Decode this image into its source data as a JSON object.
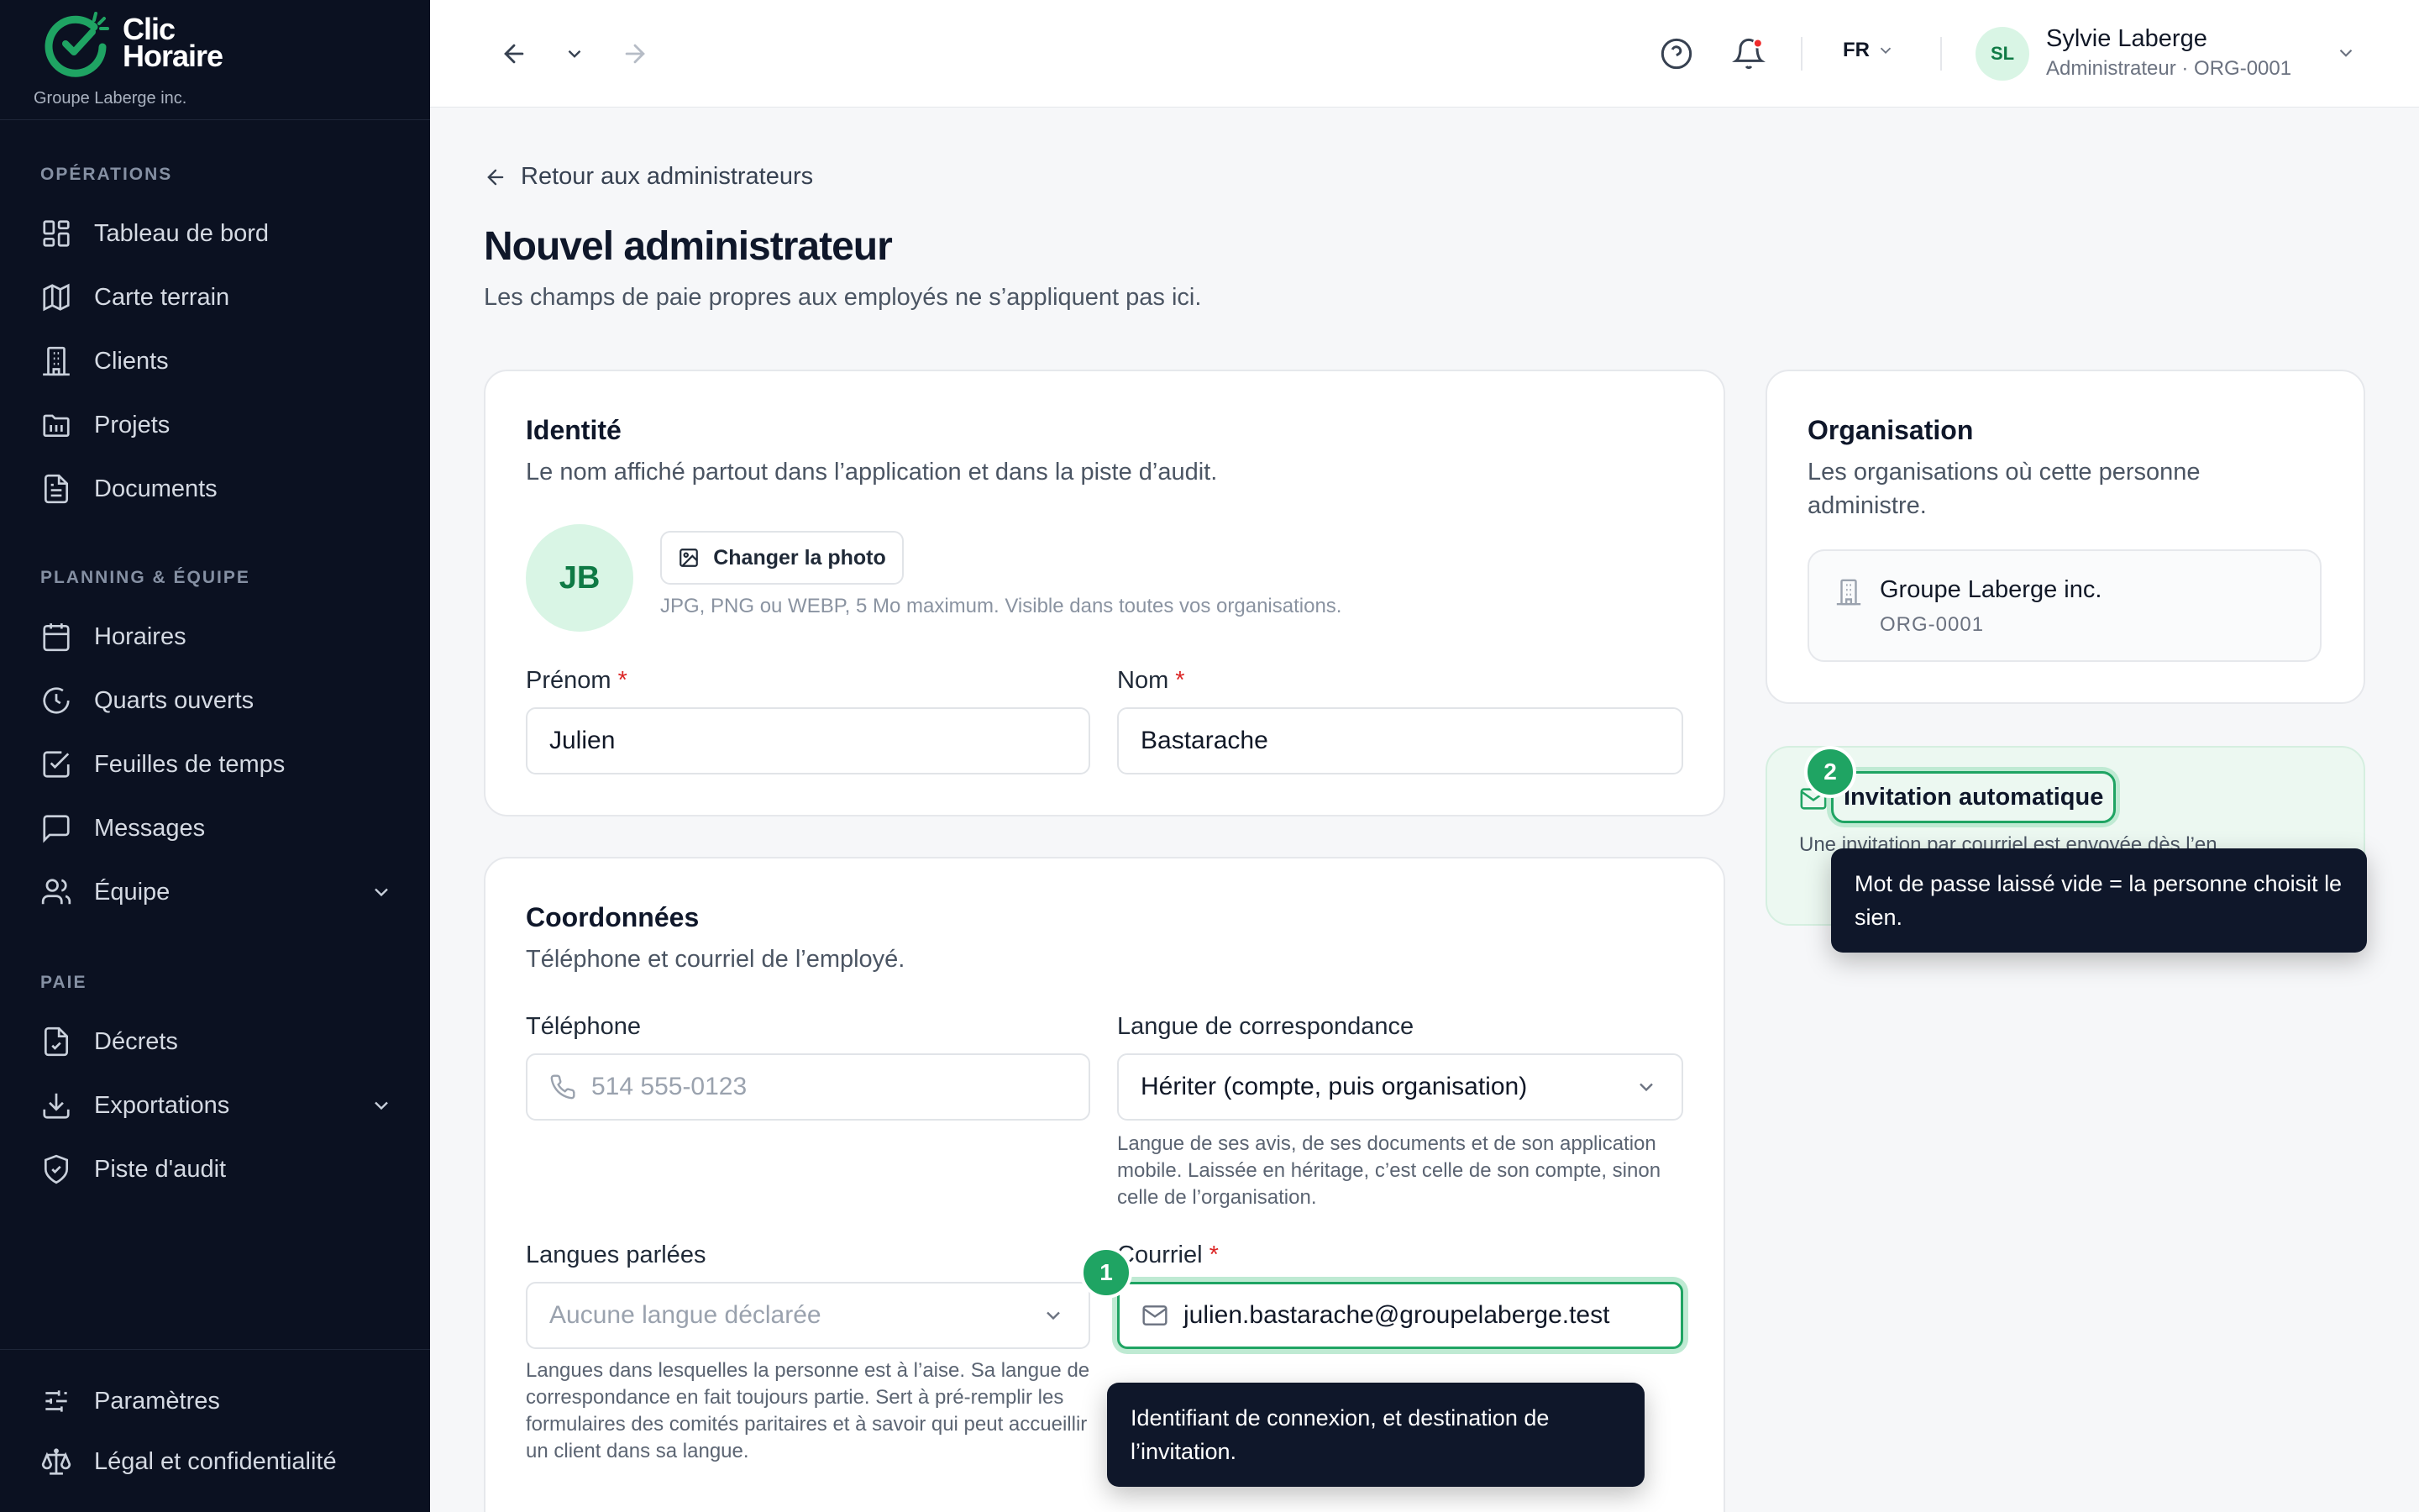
{
  "brand": {
    "name_line1": "Clic",
    "name_line2": "Horaire",
    "organization": "Groupe Laberge inc.",
    "accent": "#1fa463"
  },
  "sidebar": {
    "sections": [
      {
        "label": "OPÉRATIONS",
        "items": [
          {
            "label": "Tableau de bord",
            "icon": "dashboard-icon"
          },
          {
            "label": "Carte terrain",
            "icon": "map-icon"
          },
          {
            "label": "Clients",
            "icon": "building-icon"
          },
          {
            "label": "Projets",
            "icon": "folder-icon"
          },
          {
            "label": "Documents",
            "icon": "document-icon"
          }
        ]
      },
      {
        "label": "PLANNING & ÉQUIPE",
        "items": [
          {
            "label": "Horaires",
            "icon": "calendar-icon"
          },
          {
            "label": "Quarts ouverts",
            "icon": "clock-icon"
          },
          {
            "label": "Feuilles de temps",
            "icon": "checkbox-icon"
          },
          {
            "label": "Messages",
            "icon": "message-icon"
          },
          {
            "label": "Équipe",
            "icon": "users-icon"
          }
        ]
      },
      {
        "label": "PAIE",
        "items": [
          {
            "label": "Décrets",
            "icon": "file-check-icon"
          },
          {
            "label": "Exportations",
            "icon": "download-icon"
          },
          {
            "label": "Piste d'audit",
            "icon": "shield-check-icon"
          }
        ]
      }
    ],
    "footer": [
      {
        "label": "Paramètres",
        "icon": "sliders-icon"
      },
      {
        "label": "Légal et confidentialité",
        "icon": "scale-icon"
      }
    ]
  },
  "topbar": {
    "language": "FR",
    "user": {
      "initials": "SL",
      "name": "Sylvie Laberge",
      "role": "Administrateur · ORG-0001"
    }
  },
  "page": {
    "back_label": "Retour aux administrateurs",
    "title": "Nouvel administrateur",
    "subtitle": "Les champs de paie propres aux employés ne s’appliquent pas ici."
  },
  "identity": {
    "title": "Identité",
    "description": "Le nom affiché partout dans l’application et dans la piste d’audit.",
    "avatar_initials": "JB",
    "photo_button": "Changer la photo",
    "photo_hint": "JPG, PNG ou WEBP, 5 Mo maximum. Visible dans toutes vos organisations.",
    "first_name_label": "Prénom",
    "first_name_value": "Julien",
    "last_name_label": "Nom",
    "last_name_value": "Bastarache",
    "required_mark": "*"
  },
  "contact": {
    "title": "Coordonnées",
    "description": "Téléphone et courriel de l’employé.",
    "phone_label": "Téléphone",
    "phone_placeholder": "514 555-0123",
    "correspondence_label": "Langue de correspondance",
    "correspondence_value": "Hériter (compte, puis organisation)",
    "correspondence_help": "Langue de ses avis, de ses documents et de son application mobile. Laissée en héritage, c’est celle de son compte, sinon celle de l’organisation.",
    "spoken_label": "Langues parlées",
    "spoken_placeholder": "Aucune langue déclarée",
    "spoken_help": "Langues dans lesquelles la personne est à l’aise. Sa langue de correspondance en fait toujours partie. Sert à pré-remplir les formulaires des comités paritaires et à savoir qui peut accueillir un client dans sa langue.",
    "email_label": "Courriel",
    "email_value": "julien.bastarache@groupelaberge.test"
  },
  "organization": {
    "title": "Organisation",
    "description": "Les organisations où cette personne administre.",
    "org_name": "Groupe Laberge inc.",
    "org_code": "ORG-0001"
  },
  "invitation": {
    "title": "Invitation automatique",
    "description": "Une invitation par courriel est envoyée dès l’en"
  },
  "walkthrough": [
    {
      "step": "1",
      "text": "Identifiant de connexion, et destination de l’invitation."
    },
    {
      "step": "2",
      "text": "Mot de passe laissé vide = la personne choisit le sien."
    }
  ]
}
